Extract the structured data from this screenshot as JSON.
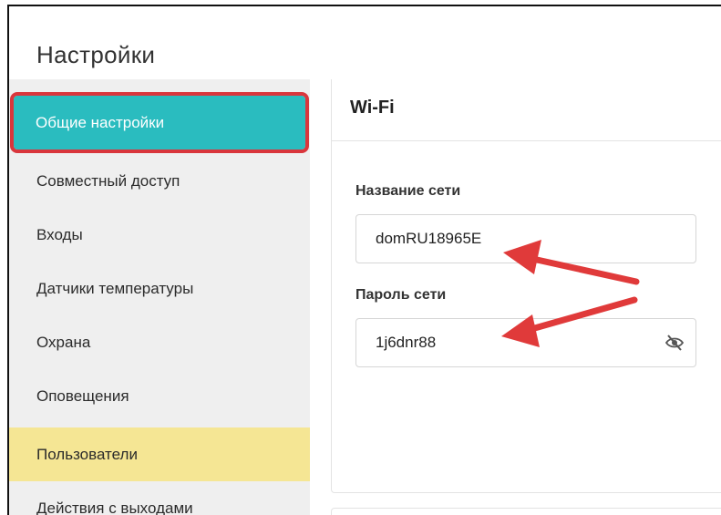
{
  "page": {
    "title": "Настройки"
  },
  "sidebar": {
    "items": [
      {
        "label": "Общие настройки"
      },
      {
        "label": "Совместный доступ"
      },
      {
        "label": "Входы"
      },
      {
        "label": "Датчики температуры"
      },
      {
        "label": "Охрана"
      },
      {
        "label": "Оповещения"
      },
      {
        "label": "Пользователи"
      },
      {
        "label": "Действия с выходами"
      }
    ]
  },
  "wifi": {
    "title": "Wi-Fi",
    "ssid_label": "Название сети",
    "ssid_value": "domRU18965E",
    "password_label": "Пароль сети",
    "password_value": "1j6dnr88",
    "visibility_icon": "eye-slash-icon"
  },
  "colors": {
    "active_item": "#2abcbf",
    "active_outline": "#d9363c",
    "highlight_item": "#f5e694",
    "annotation_arrow": "#e03a3a"
  }
}
